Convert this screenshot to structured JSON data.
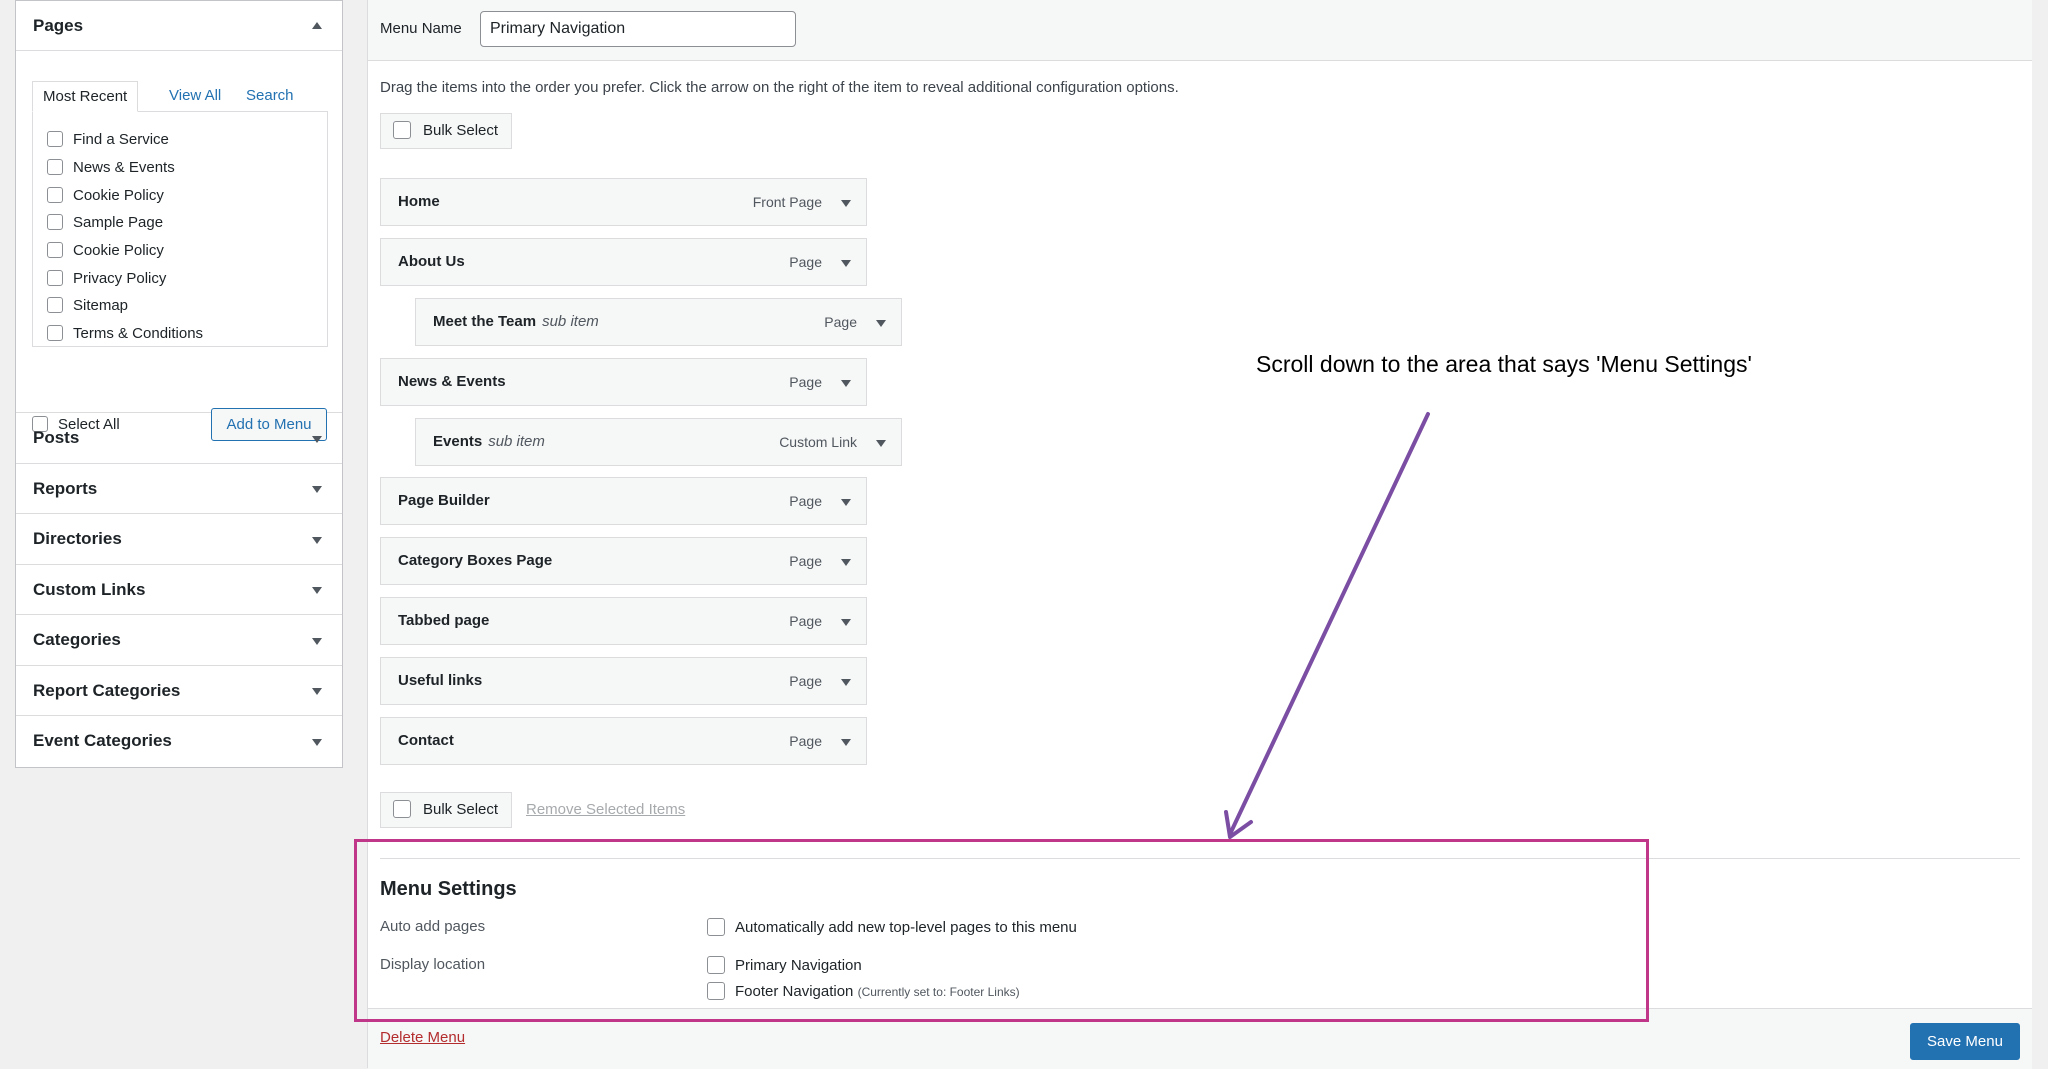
{
  "sidebar": {
    "pages": {
      "title": "Pages",
      "tabs": [
        "Most Recent",
        "View All",
        "Search"
      ],
      "items": [
        "Find a Service",
        "News & Events",
        "Cookie Policy",
        "Sample Page",
        "Cookie Policy",
        "Privacy Policy",
        "Sitemap",
        "Terms & Conditions"
      ],
      "select_all": "Select All",
      "add_button": "Add to Menu"
    },
    "sections": [
      "Posts",
      "Reports",
      "Directories",
      "Custom Links",
      "Categories",
      "Report Categories",
      "Event Categories"
    ]
  },
  "menu": {
    "name_label": "Menu Name",
    "name_value": "Primary Navigation",
    "instructions": "Drag the items into the order you prefer. Click the arrow on the right of the item to reveal additional configuration options.",
    "bulk_select": "Bulk Select",
    "remove_selected": "Remove Selected Items",
    "items": [
      {
        "title": "Home",
        "sub": "",
        "type": "Front Page"
      },
      {
        "title": "About Us",
        "sub": "",
        "type": "Page"
      },
      {
        "title": "Meet the Team",
        "sub": "sub item",
        "type": "Page"
      },
      {
        "title": "News & Events",
        "sub": "",
        "type": "Page"
      },
      {
        "title": "Events",
        "sub": "sub item",
        "type": "Custom Link"
      },
      {
        "title": "Page Builder",
        "sub": "",
        "type": "Page"
      },
      {
        "title": "Category Boxes Page",
        "sub": "",
        "type": "Page"
      },
      {
        "title": "Tabbed page",
        "sub": "",
        "type": "Page"
      },
      {
        "title": "Useful links",
        "sub": "",
        "type": "Page"
      },
      {
        "title": "Contact",
        "sub": "",
        "type": "Page"
      }
    ]
  },
  "settings": {
    "title": "Menu Settings",
    "auto_add_label": "Auto add pages",
    "auto_add_option": "Automatically add new top-level pages to this menu",
    "display_location_label": "Display location",
    "locations": [
      {
        "name": "Primary Navigation",
        "note": ""
      },
      {
        "name": "Footer Navigation",
        "note": "(Currently set to: Footer Links)"
      }
    ]
  },
  "footer": {
    "delete_link": "Delete Menu",
    "save_button": "Save Menu"
  },
  "annotation": {
    "text": "Scroll down to the area that says 'Menu Settings'",
    "color": "#7b4ea3",
    "highlight_color": "#c0378a"
  },
  "colors": {
    "accent": "#2271b1",
    "danger": "#b32d2e"
  }
}
